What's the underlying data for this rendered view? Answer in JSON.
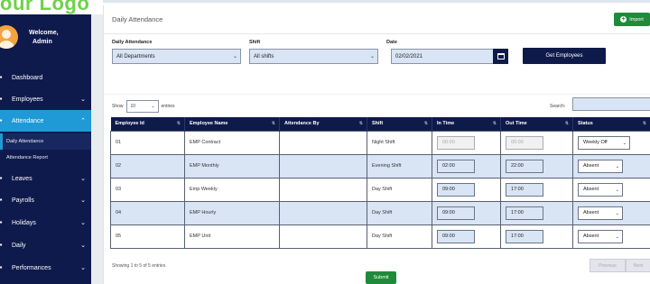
{
  "logo": {
    "text": "our Logo"
  },
  "sidebar": {
    "welcome_line1": "Welcome,",
    "welcome_line2": "Admin",
    "items": [
      {
        "label": "Dashboard",
        "icon": "dashboard-icon"
      },
      {
        "label": "Employees",
        "icon": "employees-icon"
      },
      {
        "label": "Attendance",
        "icon": "attendance-icon"
      },
      {
        "label": "Leaves",
        "icon": "leaves-icon"
      },
      {
        "label": "Payrolls",
        "icon": "payrolls-icon"
      },
      {
        "label": "Holidays",
        "icon": "holidays-icon"
      },
      {
        "label": "Daily",
        "icon": "daily-icon"
      },
      {
        "label": "Performances",
        "icon": "performances-icon"
      }
    ],
    "subitems": [
      {
        "label": "Daily Attendance"
      },
      {
        "label": "Attendance Report"
      }
    ]
  },
  "header": {
    "title": "Daily Attendance",
    "import_label": "Import"
  },
  "filters": {
    "attendance_label": "Daily Attendance",
    "attendance_value": "All Departments",
    "shift_label": "Shift",
    "shift_value": "All shifts",
    "date_label": "Date",
    "date_value": "02/02/2021",
    "get_label": "Get Employees"
  },
  "datatable": {
    "show_label": "Show",
    "length_value": "10",
    "entries_label": "entries",
    "search_label": "Search:",
    "columns": [
      "Employee Id",
      "Employee Name",
      "Attendance By",
      "Shift",
      "In Time",
      "Out Time",
      "Status"
    ],
    "rows": [
      {
        "id": "01",
        "name": "EMP Contract",
        "by": "",
        "shift": "Night Shift",
        "in": "00:00",
        "out": "00:00",
        "status": "Weekly Off",
        "disabled": true
      },
      {
        "id": "02",
        "name": "EMP Monthly",
        "by": "",
        "shift": "Evening Shift",
        "in": "02:00",
        "out": "22:00",
        "status": "Absent",
        "disabled": false
      },
      {
        "id": "03",
        "name": "Emp Weekly",
        "by": "",
        "shift": "Day Shift",
        "in": "09:00",
        "out": "17:00",
        "status": "Absent",
        "disabled": false
      },
      {
        "id": "04",
        "name": "EMP Hourly",
        "by": "",
        "shift": "Day Shift",
        "in": "09:00",
        "out": "17:00",
        "status": "Absent",
        "disabled": false
      },
      {
        "id": "05",
        "name": "EMP Unit",
        "by": "",
        "shift": "Day Shift",
        "in": "09:00",
        "out": "17:00",
        "status": "Absent",
        "disabled": false
      }
    ],
    "info": "Showing 1 to 5 of 5 entries",
    "prev_label": "Previous",
    "next_label": "Next"
  },
  "submit_label": "Submit",
  "colors": {
    "sidebar": "#0f1a4c",
    "accent": "#1f9ad6",
    "primary": "#0e1a4a",
    "success": "#1f8b3a",
    "row_alt": "#d9e5f5"
  }
}
